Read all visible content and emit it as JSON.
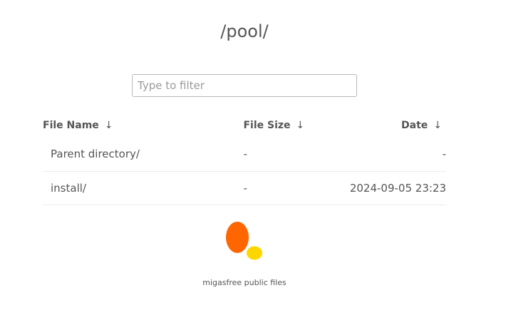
{
  "page": {
    "title": "/pool/"
  },
  "filter": {
    "placeholder": "Type to filter",
    "value": ""
  },
  "table": {
    "columns": [
      {
        "label": "File Name",
        "sort_arrow": "↓"
      },
      {
        "label": "File Size",
        "sort_arrow": "↓"
      },
      {
        "label": "Date",
        "sort_arrow": "↓"
      }
    ],
    "rows": [
      {
        "name": "Parent directory/",
        "size": "-",
        "date": "-"
      },
      {
        "name": "install/",
        "size": "-",
        "date": "2024-09-05 23:23"
      }
    ]
  },
  "logo": {
    "icon": "migasfree-logo-icon",
    "colors": {
      "large": "#ff6600",
      "small": "#ffd700"
    }
  },
  "footer": {
    "text": "migasfree public files"
  }
}
